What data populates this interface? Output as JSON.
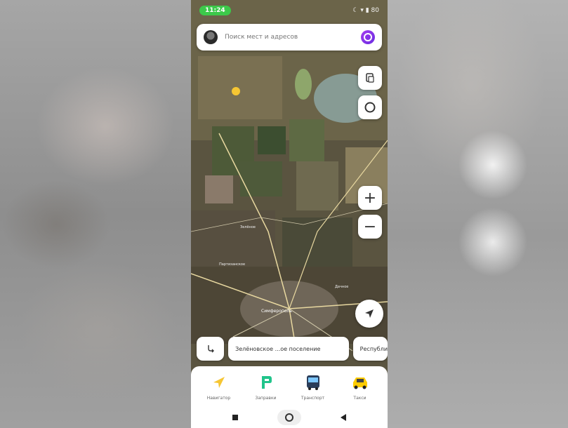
{
  "status": {
    "time": "11:24",
    "right": "☾ ▾ ▮ 80"
  },
  "search": {
    "placeholder": "Поиск мест и адресов"
  },
  "map": {
    "zoom_in": "+",
    "zoom_out": "−",
    "labels": [
      "Зелёное",
      "Партизанское",
      "Дачное",
      "Симферополь"
    ]
  },
  "chips": {
    "place": "Зелёновское ...ое поселение",
    "more": "Республика"
  },
  "services": [
    {
      "label": "Навигатор",
      "icon": "navigator-icon"
    },
    {
      "label": "Заправки",
      "icon": "fuel-icon"
    },
    {
      "label": "Транспорт",
      "icon": "bus-icon"
    },
    {
      "label": "Такси",
      "icon": "taxi-icon"
    }
  ],
  "colors": {
    "accent": "#a33cf0",
    "status_green": "#3cc94a",
    "fuel_green": "#21c48b",
    "navigator_yellow": "#f6c633",
    "taxi_yellow": "#ffcc00"
  }
}
